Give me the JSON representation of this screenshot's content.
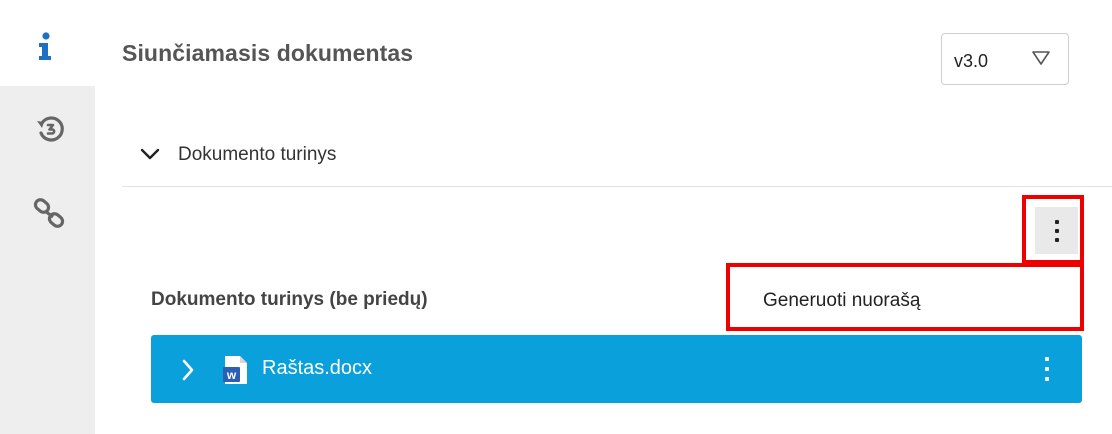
{
  "sidebar": {
    "tabs": [
      {
        "icon": "info-icon",
        "active": true
      },
      {
        "icon": "history-icon",
        "active": false
      },
      {
        "icon": "link-icon",
        "active": false
      }
    ]
  },
  "header": {
    "title": "Siunčiamasis dokumentas",
    "version_selected": "v3.0"
  },
  "section": {
    "title": "Dokumento turinys",
    "expanded": true
  },
  "menu": {
    "items": [
      "Generuoti nuorašą"
    ]
  },
  "content": {
    "subheading": "Dokumento turinys (be priedų)",
    "files": [
      {
        "name": "Raštas.docx",
        "icon": "word-file-icon",
        "icon_letter": "w"
      }
    ]
  },
  "colors": {
    "accent": "#0aa0dc",
    "highlight": "#ee0000",
    "rail_bg": "#eeeeee",
    "info_icon": "#1f6fc5"
  }
}
